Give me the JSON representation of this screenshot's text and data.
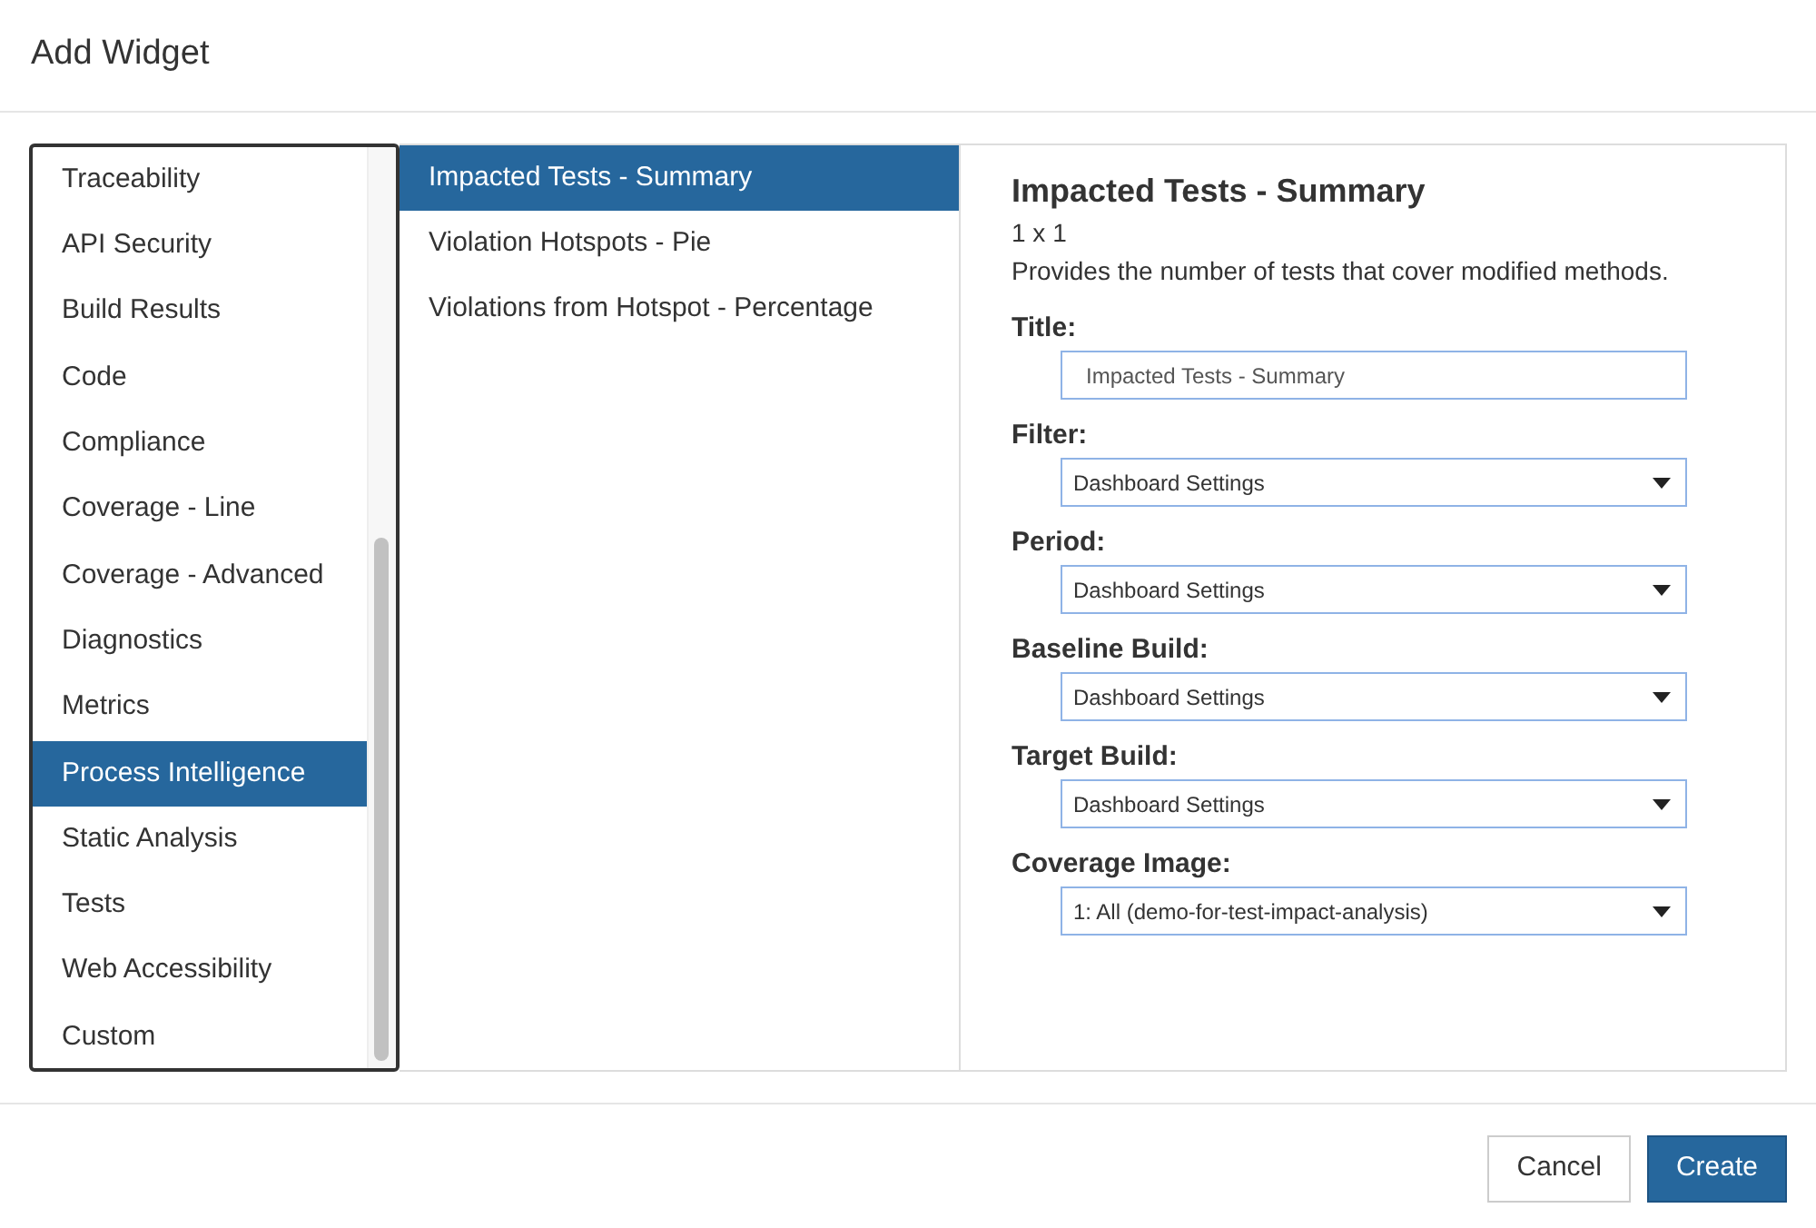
{
  "dialog": {
    "title": "Add Widget"
  },
  "categories": [
    {
      "label": "Traceability",
      "selected": false
    },
    {
      "label": "API Security",
      "selected": false
    },
    {
      "label": "Build Results",
      "selected": false
    },
    {
      "label": "Code",
      "selected": false
    },
    {
      "label": "Compliance",
      "selected": false
    },
    {
      "label": "Coverage - Line",
      "selected": false
    },
    {
      "label": "Coverage - Advanced",
      "selected": false
    },
    {
      "label": "Diagnostics",
      "selected": false
    },
    {
      "label": "Metrics",
      "selected": false
    },
    {
      "label": "Process Intelligence",
      "selected": true
    },
    {
      "label": "Static Analysis",
      "selected": false
    },
    {
      "label": "Tests",
      "selected": false
    },
    {
      "label": "Web Accessibility",
      "selected": false
    },
    {
      "label": "Custom",
      "selected": false
    }
  ],
  "widgets": [
    {
      "label": "Impacted Tests - Summary",
      "selected": true
    },
    {
      "label": "Violation Hotspots - Pie",
      "selected": false
    },
    {
      "label": "Violations from Hotspot - Percentage",
      "selected": false
    }
  ],
  "details": {
    "title": "Impacted Tests - Summary",
    "size": "1 x 1",
    "description": "Provides the number of tests that cover modified methods.",
    "fields": [
      {
        "kind": "text",
        "label": "Title:",
        "value": "Impacted Tests - Summary"
      },
      {
        "kind": "select",
        "label": "Filter:",
        "value": "Dashboard Settings"
      },
      {
        "kind": "select",
        "label": "Period:",
        "value": "Dashboard Settings"
      },
      {
        "kind": "select",
        "label": "Baseline Build:",
        "value": "Dashboard Settings"
      },
      {
        "kind": "select",
        "label": "Target Build:",
        "value": "Dashboard Settings"
      },
      {
        "kind": "select",
        "label": "Coverage Image:",
        "value": "1: All (demo-for-test-impact-analysis)"
      }
    ]
  },
  "buttons": [
    {
      "label": "Cancel",
      "kind": "secondary"
    },
    {
      "label": "Create",
      "kind": "primary"
    }
  ]
}
